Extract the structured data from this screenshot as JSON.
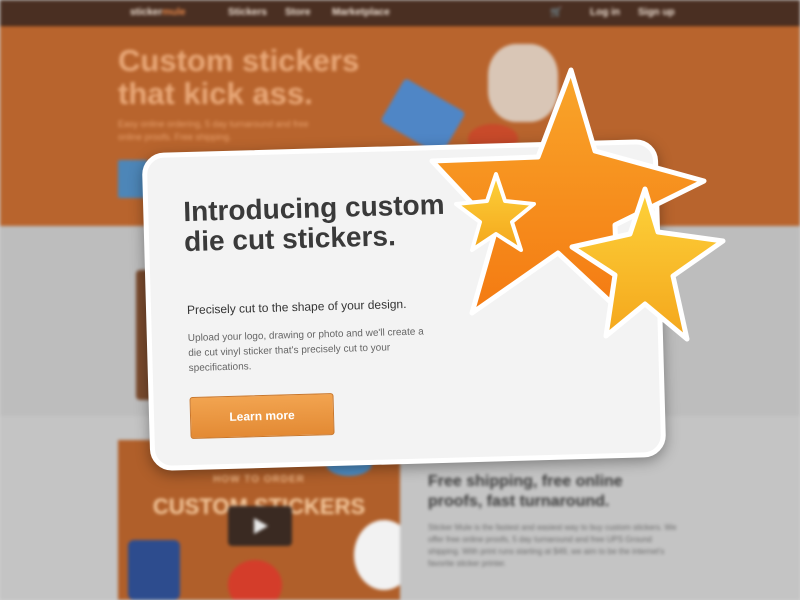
{
  "nav": {
    "logo_prefix": "sticker",
    "logo_suffix": "mule",
    "links": [
      "Stickers",
      "Store",
      "Marketplace"
    ],
    "cart_icon": "cart-icon",
    "login": "Log in",
    "signup": "Sign up"
  },
  "hero": {
    "title": "Custom stickers that kick ass.",
    "subtitle": "Easy online ordering, 5 day turnaround and free online proofs. Free shipping."
  },
  "video": {
    "small_caption": "HOW TO ORDER",
    "title": "CUSTOM STICKERS"
  },
  "features": {
    "heading": "Free shipping, free online proofs, fast turnaround.",
    "text": "Sticker Mule is the fastest and easiest way to buy custom stickers. We offer free online proofs, 5 day turnaround and free UPS Ground shipping. With print runs starting at $49, we aim to be the internet's favorite sticker printer."
  },
  "modal": {
    "title": "Introducing custom die cut stickers.",
    "tagline": "Precisely cut to the shape of your design.",
    "description": "Upload your logo, drawing or photo and we'll create a die cut vinyl sticker that's precisely cut to your specifications.",
    "button": "Learn more"
  },
  "colors": {
    "brand_orange": "#e38a34",
    "nav_brown": "#4a2f22",
    "star_orange": "#f7921e",
    "star_yellow": "#fbc02d"
  }
}
